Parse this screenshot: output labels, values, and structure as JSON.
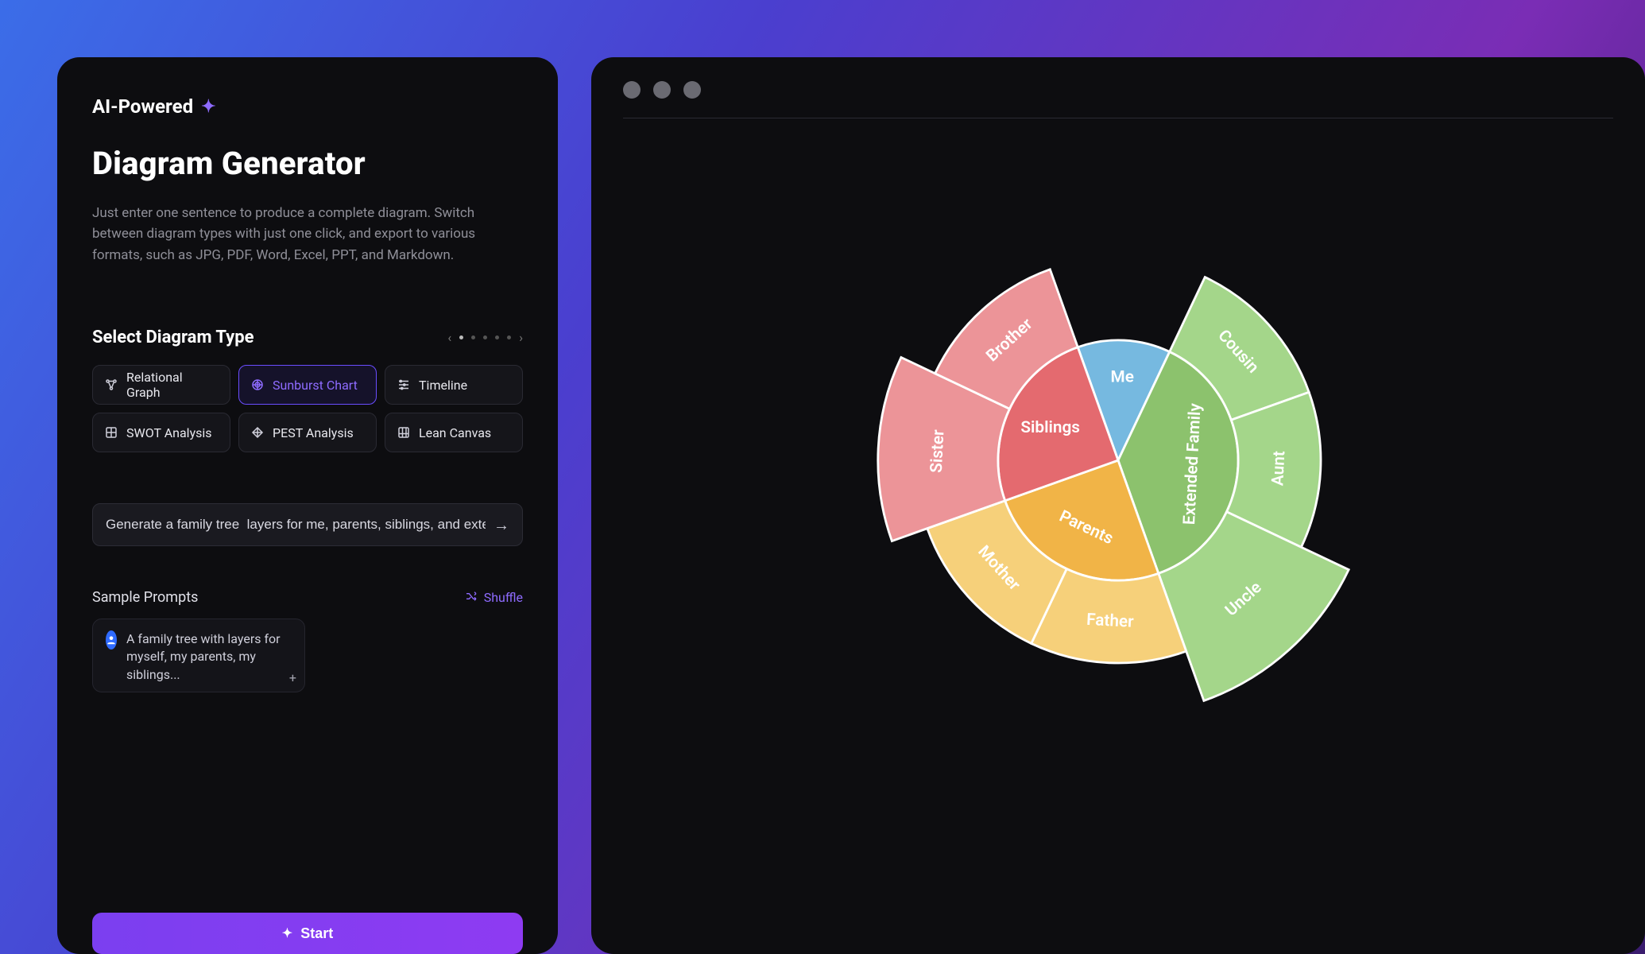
{
  "badge": "AI-Powered",
  "title": "Diagram Generator",
  "subtitle": "Just enter one sentence to produce a complete diagram. Switch between diagram types with just one click, and export to various formats, such as JPG, PDF, Word, Excel, PPT, and Markdown.",
  "section_label": "Select Diagram Type",
  "diagram_types": [
    {
      "label": "Relational Graph",
      "selected": false
    },
    {
      "label": "Sunburst Chart",
      "selected": true
    },
    {
      "label": "Timeline",
      "selected": false
    },
    {
      "label": "SWOT Analysis",
      "selected": false
    },
    {
      "label": "PEST Analysis",
      "selected": false
    },
    {
      "label": "Lean Canvas",
      "selected": false
    }
  ],
  "prompt_value": "Generate a family tree  layers for me, parents, siblings, and extended family",
  "sample_label": "Sample Prompts",
  "shuffle_label": "Shuffle",
  "sample_text": "A family tree with layers for myself, my parents, my siblings...",
  "start_label": "Start",
  "colors": {
    "accent": "#8e6bff",
    "me": "#76b9e0",
    "siblings": "#e46a6f",
    "siblings_outer": "#ec9498",
    "parents": "#f1b447",
    "parents_outer": "#f6d07a",
    "extended": "#8cc26d",
    "extended_outer": "#a4d68a"
  },
  "chart_data": {
    "type": "sunburst",
    "title": "",
    "root": [
      {
        "name": "Me",
        "value": 1,
        "color": "me",
        "children": []
      },
      {
        "name": "Siblings",
        "value": 2,
        "color": "siblings",
        "children": [
          {
            "name": "Sister",
            "value": 1,
            "color": "siblings_outer"
          },
          {
            "name": "Brother",
            "value": 1,
            "color": "siblings_outer"
          }
        ]
      },
      {
        "name": "Parents",
        "value": 2,
        "color": "parents",
        "children": [
          {
            "name": "Father",
            "value": 1,
            "color": "parents_outer"
          },
          {
            "name": "Mother",
            "value": 1,
            "color": "parents_outer"
          }
        ]
      },
      {
        "name": "Extended Family",
        "value": 3,
        "color": "extended",
        "children": [
          {
            "name": "Cousin",
            "value": 1,
            "color": "extended_outer"
          },
          {
            "name": "Aunt",
            "value": 1,
            "color": "extended_outer"
          },
          {
            "name": "Uncle",
            "value": 1,
            "color": "extended_outer"
          }
        ]
      }
    ]
  }
}
